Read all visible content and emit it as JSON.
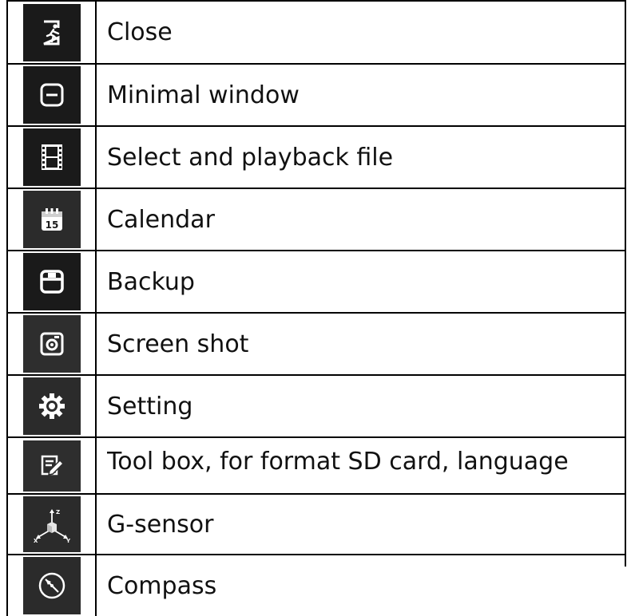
{
  "rows": [
    {
      "icon": "exit-door-icon",
      "label": "Close"
    },
    {
      "icon": "minimize-icon",
      "label": "Minimal window"
    },
    {
      "icon": "film-icon",
      "label": "Select and playback file"
    },
    {
      "icon": "calendar-icon",
      "label": "Calendar",
      "icon_text": "15"
    },
    {
      "icon": "save-icon",
      "label": "Backup"
    },
    {
      "icon": "screenshot-icon",
      "label": "Screen shot"
    },
    {
      "icon": "gear-icon",
      "label": "Setting"
    },
    {
      "icon": "edit-icon",
      "label": "Tool box, for format SD card, language"
    },
    {
      "icon": "g-sensor-icon",
      "label": "G-sensor",
      "icon_text": [
        "Z",
        "X",
        "Y"
      ]
    },
    {
      "icon": "compass-icon",
      "label": "Compass"
    }
  ],
  "colors": {
    "icon_background": "#1a1a1a",
    "icon_foreground": "#ffffff",
    "border": "#000000"
  }
}
